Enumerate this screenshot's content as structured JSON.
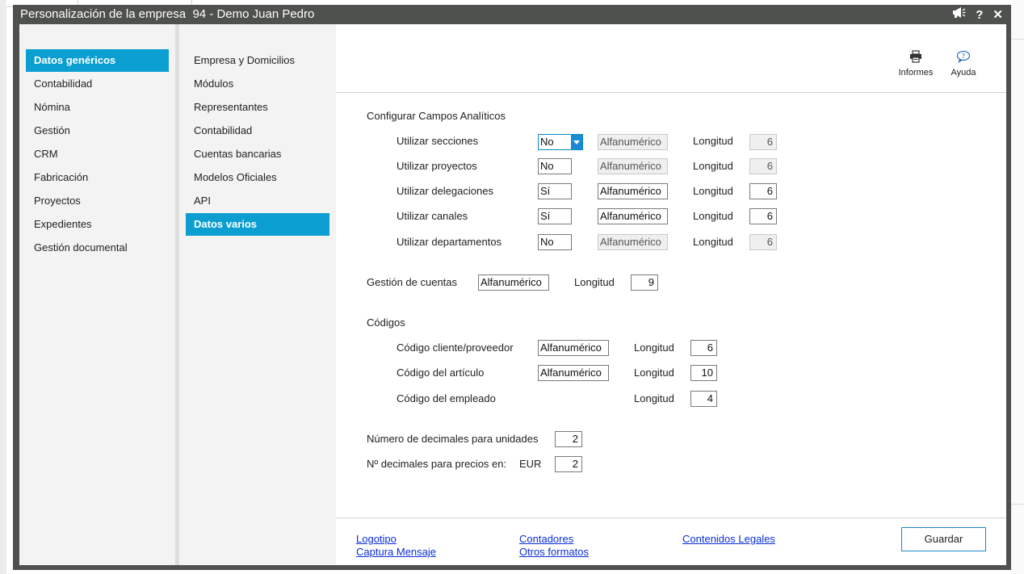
{
  "window": {
    "title": "Personalización de la empresa  94 - Demo Juan Pedro"
  },
  "titlebar_icons": [
    "megaphone-icon",
    "help-icon",
    "close-icon"
  ],
  "titlebar_glyphs": {
    "help": "?",
    "close": "✕"
  },
  "nav_primary": [
    {
      "label": "Datos genéricos",
      "active": true
    },
    {
      "label": "Contabilidad"
    },
    {
      "label": "Nómina"
    },
    {
      "label": "Gestión"
    },
    {
      "label": "CRM"
    },
    {
      "label": "Fabricación"
    },
    {
      "label": "Proyectos"
    },
    {
      "label": "Expedientes"
    },
    {
      "label": "Gestión documental"
    }
  ],
  "nav_secondary": [
    {
      "label": "Empresa y Domicilios"
    },
    {
      "label": "Módulos"
    },
    {
      "label": "Representantes"
    },
    {
      "label": "Contabilidad"
    },
    {
      "label": "Cuentas bancarias"
    },
    {
      "label": "Modelos Oficiales"
    },
    {
      "label": "API"
    },
    {
      "label": "Datos varios",
      "active": true
    }
  ],
  "toolbar": {
    "informes": "Informes",
    "ayuda": "Ayuda"
  },
  "analiticos": {
    "heading": "Configurar Campos Analíticos",
    "longitud_label": "Longitud",
    "rows": [
      {
        "label": "Utilizar secciones",
        "value": "No",
        "type": "Alfanumérico",
        "length": "6"
      },
      {
        "label": "Utilizar proyectos",
        "value": "No",
        "type": "Alfanumérico",
        "length": "6"
      },
      {
        "label": "Utilizar delegaciones",
        "value": "Sí",
        "type": "Alfanumérico",
        "length": "6"
      },
      {
        "label": "Utilizar canales",
        "value": "Sí",
        "type": "Alfanumérico",
        "length": "6"
      },
      {
        "label": "Utilizar departamentos",
        "value": "No",
        "type": "Alfanumérico",
        "length": "6"
      }
    ]
  },
  "cuentas": {
    "label": "Gestión de cuentas",
    "type": "Alfanumérico",
    "longitud_label": "Longitud",
    "length": "9"
  },
  "codigos": {
    "heading": "Códigos",
    "longitud_label": "Longitud",
    "rows": [
      {
        "label": "Código cliente/proveedor",
        "type": "Alfanumérico",
        "length": "6"
      },
      {
        "label": "Código del artículo",
        "type": "Alfanumérico",
        "length": "10"
      },
      {
        "label": "Código del empleado",
        "length": "4"
      }
    ]
  },
  "decimales": {
    "unidades_label": "Número de decimales para unidades",
    "unidades_value": "2",
    "precios_label": "Nº decimales para precios en:",
    "currency": "EUR",
    "precios_value": "2"
  },
  "footer": {
    "links": [
      "Logotipo",
      "Captura Mensaje",
      "Contadores",
      "Otros formatos",
      "Contenidos Legales"
    ],
    "save_label": "Guardar"
  },
  "colors": {
    "accent": "#0b9fd1",
    "titlebar": "#4f514e",
    "link": "#0a2fd6"
  }
}
